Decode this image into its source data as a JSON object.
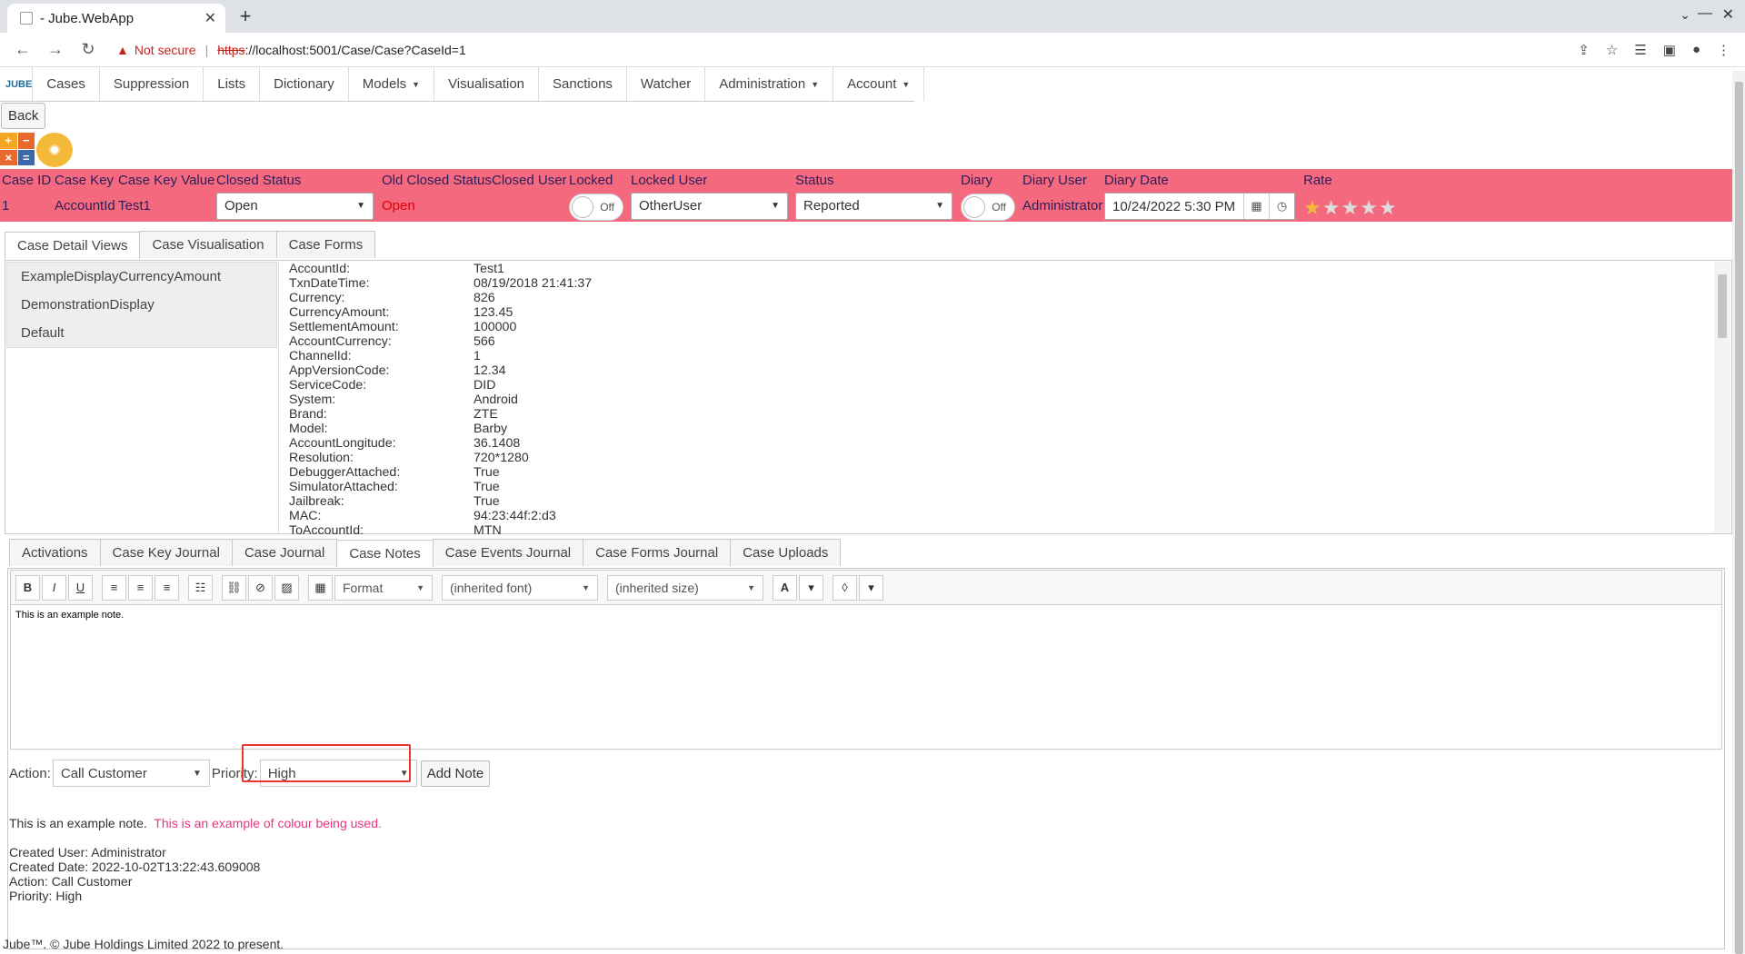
{
  "browser": {
    "tab_title": "- Jube.WebApp",
    "not_secure": "Not secure",
    "url_scheme": "https",
    "url_rest": "://localhost:5001/Case/Case?CaseId=1"
  },
  "menu": {
    "logo": "JUBE",
    "items": [
      "Cases",
      "Suppression",
      "Lists",
      "Dictionary",
      "Models",
      "Visualisation",
      "Sanctions",
      "Watcher",
      "Administration",
      "Account"
    ]
  },
  "back_label": "Back",
  "case_header": {
    "labels": {
      "case_id": "Case ID",
      "case_key": "Case Key",
      "case_key_value": "Case Key Value",
      "closed_status": "Closed Status",
      "old_closed_status": "Old Closed Status",
      "closed_user": "Closed User",
      "locked": "Locked",
      "locked_user": "Locked User",
      "status": "Status",
      "diary": "Diary",
      "diary_user": "Diary User",
      "diary_date": "Diary Date",
      "rate": "Rate"
    },
    "values": {
      "case_id": "1",
      "case_key": "AccountId",
      "case_key_value": "Test1",
      "closed_status": "Open",
      "old_closed_status": "Open",
      "locked": "Off",
      "locked_user": "OtherUser",
      "status": "Reported",
      "diary": "Off",
      "diary_user": "Administrator",
      "diary_date": "10/24/2022 5:30 PM",
      "rating": 1
    }
  },
  "top_tabs": [
    "Case Detail Views",
    "Case Visualisation",
    "Case Forms"
  ],
  "views": [
    "ExampleDisplayCurrencyAmount",
    "DemonstrationDisplay",
    "Default"
  ],
  "details": [
    [
      "AccountId:",
      "Test1"
    ],
    [
      "TxnDateTime:",
      "08/19/2018 21:41:37"
    ],
    [
      "Currency:",
      "826"
    ],
    [
      "CurrencyAmount:",
      "123.45"
    ],
    [
      "SettlementAmount:",
      "100000"
    ],
    [
      "AccountCurrency:",
      "566"
    ],
    [
      "ChannelId:",
      "1"
    ],
    [
      "AppVersionCode:",
      "12.34"
    ],
    [
      "ServiceCode:",
      "DID"
    ],
    [
      "System:",
      "Android"
    ],
    [
      "Brand:",
      "ZTE"
    ],
    [
      "Model:",
      "Barby"
    ],
    [
      "AccountLongitude:",
      "36.1408"
    ],
    [
      "Resolution:",
      "720*1280"
    ],
    [
      "DebuggerAttached:",
      "True"
    ],
    [
      "SimulatorAttached:",
      "True"
    ],
    [
      "Jailbreak:",
      "True"
    ],
    [
      "MAC:",
      "94:23:44f:2:d3"
    ],
    [
      "ToAccountId:",
      "MTN"
    ]
  ],
  "bottom_tabs": [
    "Activations",
    "Case Key Journal",
    "Case Journal",
    "Case Notes",
    "Case Events Journal",
    "Case Forms Journal",
    "Case Uploads"
  ],
  "editor": {
    "format": "Format",
    "font": "(inherited font)",
    "size": "(inherited size)",
    "content": "This is an example note."
  },
  "action_row": {
    "action_label": "Action:",
    "action_value": "Call Customer",
    "priority_label": "Priority:",
    "priority_value": "High",
    "add_note": "Add Note"
  },
  "note": {
    "text": "This is an example note.",
    "colored": "This is an example of colour being used.",
    "created_user": "Created User: Administrator",
    "created_date": "Created Date: 2022-10-02T13:22:43.609008",
    "action": "Action: Call Customer",
    "priority": "Priority: High"
  },
  "footer": "Jube™. © Jube Holdings Limited 2022 to present."
}
